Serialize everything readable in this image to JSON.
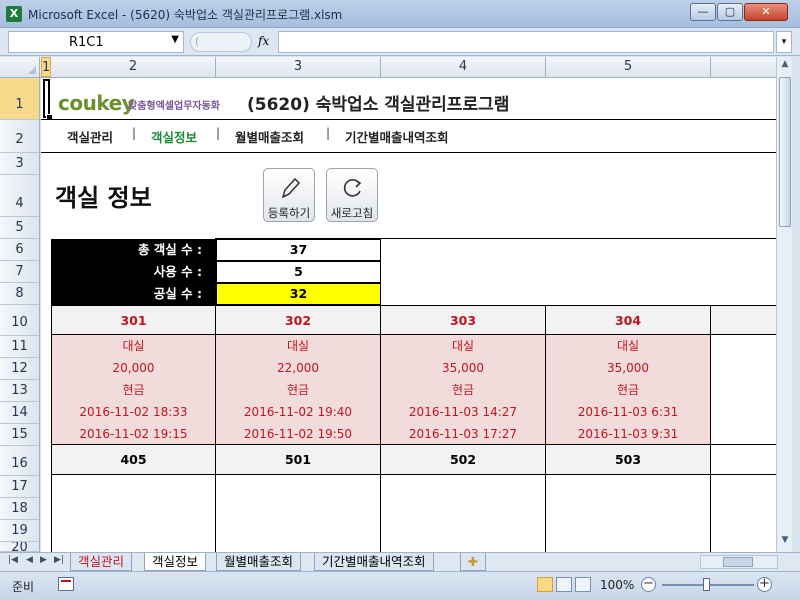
{
  "window": {
    "title": "Microsoft Excel - (5620) 숙박업소 객실관리프로그램.xlsm",
    "app_icon": "X",
    "controls": [
      "minimize",
      "maximize",
      "close"
    ]
  },
  "formula_bar": {
    "name_box": "R1C1",
    "fx_label": "fx",
    "formula": ""
  },
  "column_headers": [
    "1",
    "2",
    "3",
    "4",
    "5"
  ],
  "row_headers": [
    "1",
    "2",
    "3",
    "4",
    "5",
    "6",
    "7",
    "8",
    "10",
    "11",
    "12",
    "13",
    "14",
    "15",
    "16",
    "17",
    "18",
    "19",
    "20"
  ],
  "header": {
    "logo": "coukey",
    "logo_sub": "맞춤형엑셀업무자동화",
    "title": "(5620) 숙박업소 객실관리프로그램"
  },
  "nav": {
    "items": [
      "객실관리",
      "객실정보",
      "월별매출조회",
      "기간별매출내역조회"
    ],
    "separator": "|",
    "active": "객실정보"
  },
  "page_title": "객실 정보",
  "buttons": {
    "register": "등록하기",
    "refresh": "새로고침"
  },
  "stats": {
    "total_label": "총 객실 수 :",
    "total_value": "37",
    "used_label": "사용 수 :",
    "used_value": "5",
    "vacant_label": "공실 수 :",
    "vacant_value": "32"
  },
  "rooms_row1": [
    {
      "number": "301",
      "type": "대실",
      "price": "20,000",
      "payment": "현금",
      "checkin": "2016-11-02 18:33",
      "checkout": "2016-11-02 19:15"
    },
    {
      "number": "302",
      "type": "대실",
      "price": "22,000",
      "payment": "현금",
      "checkin": "2016-11-02 19:40",
      "checkout": "2016-11-02 19:50"
    },
    {
      "number": "303",
      "type": "대실",
      "price": "35,000",
      "payment": "현금",
      "checkin": "2016-11-03 14:27",
      "checkout": "2016-11-03 17:27"
    },
    {
      "number": "304",
      "type": "대실",
      "price": "35,000",
      "payment": "현금",
      "checkin": "2016-11-03 6:31",
      "checkout": "2016-11-03 9:31"
    }
  ],
  "rooms_row2": [
    {
      "number": "405"
    },
    {
      "number": "501"
    },
    {
      "number": "502"
    },
    {
      "number": "503"
    }
  ],
  "sheet_tabs": [
    "객실관리",
    "객실정보",
    "월별매출조회",
    "기간별매출내역조회"
  ],
  "active_tab": "객실정보",
  "status": {
    "ready": "준비",
    "zoom": "100%"
  },
  "colors": {
    "occupied_bg": "#f2dcdb",
    "occupied_text": "#c0141e",
    "active_nav": "#1a8a33",
    "vacant_highlight": "#ffff00"
  }
}
